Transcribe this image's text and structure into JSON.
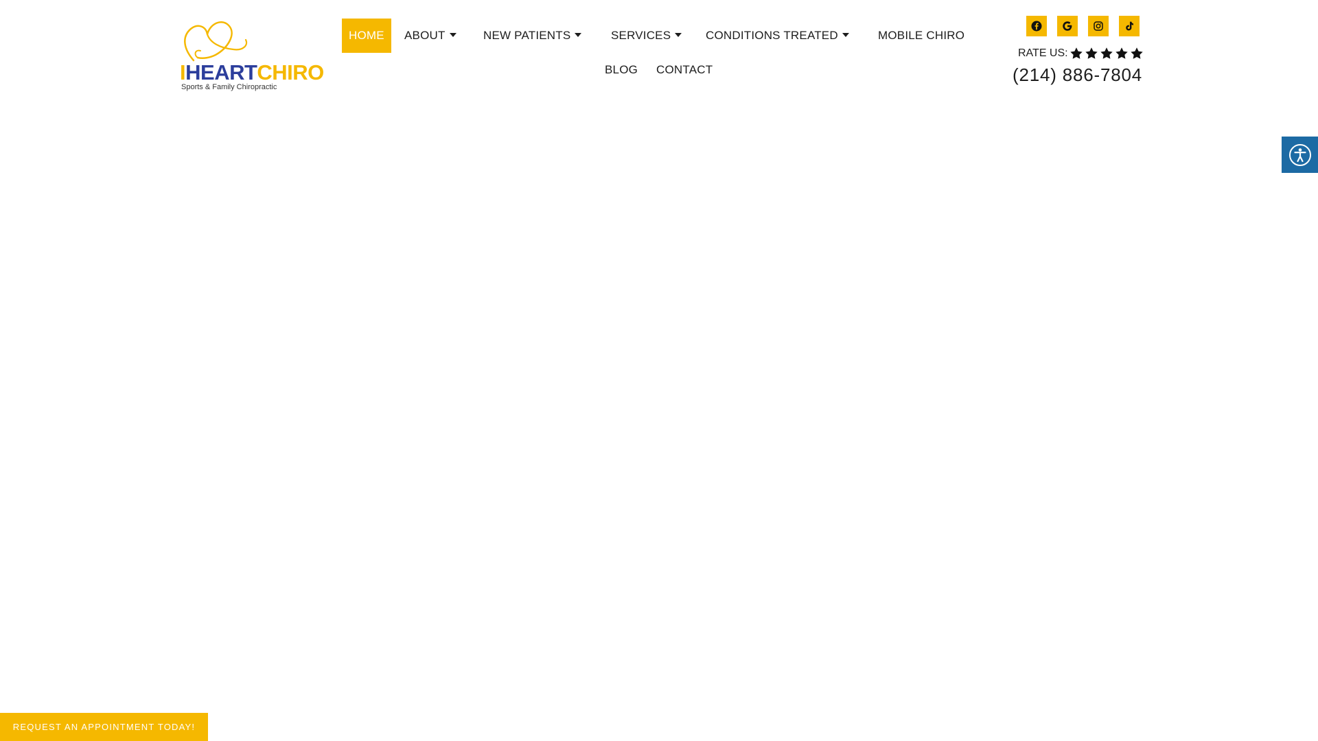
{
  "brand": {
    "logo_letter_i": "I",
    "logo_heart": "HEART",
    "logo_chiro": "CHIRO",
    "tagline": "Sports & Family Chiropractic",
    "primary_color": "#f5b800",
    "secondary_color": "#2c3e9c"
  },
  "nav": {
    "items": [
      {
        "label": "HOME",
        "active": true,
        "dropdown": false
      },
      {
        "label": "ABOUT",
        "active": false,
        "dropdown": true
      },
      {
        "label": "NEW PATIENTS",
        "active": false,
        "dropdown": true
      },
      {
        "label": "SERVICES",
        "active": false,
        "dropdown": true
      },
      {
        "label": "CONDITIONS TREATED",
        "active": false,
        "dropdown": true
      },
      {
        "label": "MOBILE CHIRO",
        "active": false,
        "dropdown": false
      },
      {
        "label": "BLOG",
        "active": false,
        "dropdown": false
      },
      {
        "label": "CONTACT",
        "active": false,
        "dropdown": false
      }
    ]
  },
  "header_right": {
    "social_icons": [
      "facebook-icon",
      "google-icon",
      "instagram-icon",
      "tiktok-icon"
    ],
    "rate_label": "RATE US:",
    "star_count": 5,
    "phone": "(214) 886-7804"
  },
  "accessibility": {
    "icon": "accessibility-icon",
    "color": "#1c6aa4"
  },
  "cta": {
    "label": "REQUEST AN APPOINTMENT TODAY!"
  }
}
